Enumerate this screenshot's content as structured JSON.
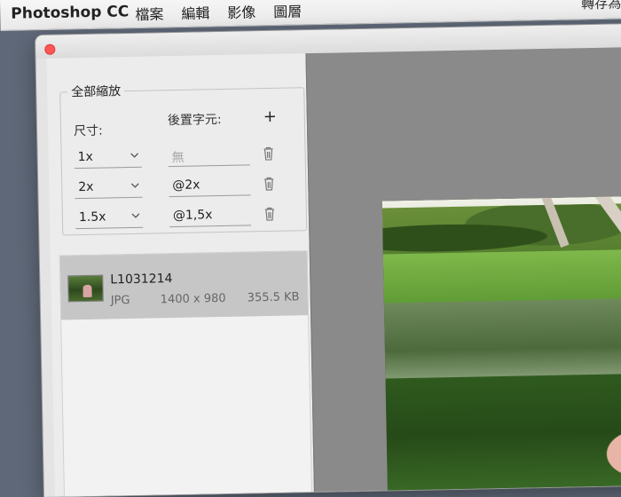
{
  "menubar": {
    "app_name": "Photoshop CC",
    "menus": [
      "檔案",
      "編輯",
      "影像",
      "圖層"
    ],
    "right_text": "轉存為"
  },
  "panel": {
    "legend": "全部縮放",
    "size_label": "尺寸:",
    "suffix_label": "後置字元:",
    "rows": [
      {
        "scale": "1x",
        "suffix": "",
        "suffix_placeholder": "無"
      },
      {
        "scale": "2x",
        "suffix": "@2x",
        "suffix_placeholder": ""
      },
      {
        "scale": "1.5x",
        "suffix": "@1,5x",
        "suffix_placeholder": ""
      }
    ]
  },
  "file": {
    "name": "L1031214",
    "type": "JPG",
    "dimensions": "1400 x 980",
    "size": "355.5 KB"
  },
  "icons": {
    "add": "plus-icon",
    "delete": "trash-icon",
    "dropdown": "chevron-down-icon",
    "close": "close-icon"
  },
  "colors": {
    "close_button": "#fc5753",
    "selected_row": "#c6c6c6",
    "preview_bg": "#8a8a8a"
  }
}
